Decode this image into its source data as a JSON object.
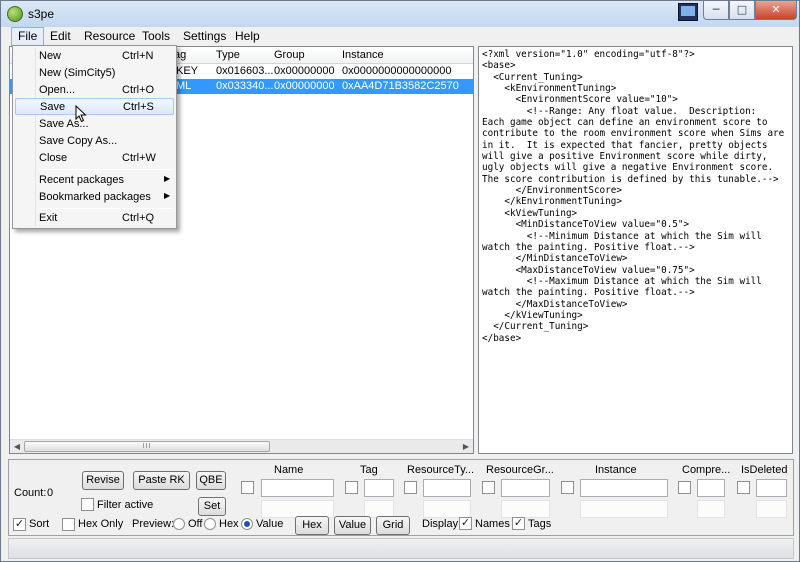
{
  "window": {
    "title": "s3pe"
  },
  "menubar": [
    "File",
    "Edit",
    "Resource",
    "Tools",
    "Settings",
    "Help"
  ],
  "list": {
    "headers": [
      "Tag",
      "Type",
      "Group",
      "Instance"
    ],
    "header_partial": "ag",
    "rows": [
      {
        "tag": "KEY",
        "type": "0x016603...",
        "group": "0x00000000",
        "instance": "0x0000000000000000"
      },
      {
        "tag": "XML",
        "type": "0x033340...",
        "group": "0x00000000",
        "instance": "0xAA4D71B3582C2570"
      }
    ],
    "row_tags_partial": [
      "KEY",
      "ML"
    ]
  },
  "xml_text": "<?xml version=\"1.0\" encoding=\"utf-8\"?>\n<base>\n  <Current_Tuning>\n    <kEnvironmentTuning>\n      <EnvironmentScore value=\"10\">\n        <!--Range: Any float value.  Description:\nEach game object can define an environment score to\ncontribute to the room environment score when Sims are\nin it.  It is expected that fancier, pretty objects\nwill give a positive Environment score while dirty,\nugly objects will give a negative Environment score.\nThe score contribution is defined by this tunable.-->\n      </EnvironmentScore>\n    </kEnvironmentTuning>\n    <kViewTuning>\n      <MinDistanceToView value=\"0.5\">\n        <!--Minimum Distance at which the Sim will\nwatch the painting. Positive float.-->\n      </MinDistanceToView>\n      <MaxDistanceToView value=\"0.75\">\n        <!--Maximum Distance at which the Sim will\nwatch the painting. Positive float.-->\n      </MaxDistanceToView>\n    </kViewTuning>\n  </Current_Tuning>\n</base>",
  "file_menu": {
    "items": [
      {
        "label": "New",
        "shortcut": "Ctrl+N"
      },
      {
        "label": "New (SimCity5)",
        "shortcut": ""
      },
      {
        "label": "Open...",
        "shortcut": "Ctrl+O"
      },
      {
        "label": "Save",
        "shortcut": "Ctrl+S",
        "highlighted": true
      },
      {
        "label": "Save As...",
        "shortcut": ""
      },
      {
        "label": "Save Copy As...",
        "shortcut": ""
      },
      {
        "label": "Close",
        "shortcut": "Ctrl+W"
      },
      {
        "label": "Recent packages",
        "shortcut": "",
        "submenu": true
      },
      {
        "label": "Bookmarked packages",
        "shortcut": "",
        "submenu": true
      },
      {
        "label": "Exit",
        "shortcut": "Ctrl+Q"
      }
    ]
  },
  "filter": {
    "count_label": "Count:",
    "count_value": "0",
    "revise": "Revise",
    "paste_rk": "Paste RK",
    "qbe": "QBE",
    "set": "Set",
    "filter_active": "Filter active",
    "columns": [
      "Name",
      "Tag",
      "ResourceTy...",
      "ResourceGr...",
      "Instance",
      "Compre...",
      "IsDeleted"
    ]
  },
  "view": {
    "sort": "Sort",
    "sort_checked": true,
    "hex_only": "Hex Only",
    "hex_only_checked": false,
    "preview": "Preview:",
    "preview_options": [
      "Off",
      "Hex",
      "Value"
    ],
    "preview_selected": "Value",
    "hex_btn": "Hex",
    "value_btn": "Value",
    "grid_btn": "Grid",
    "display": "Display:",
    "names": "Names",
    "names_checked": true,
    "tags": "Tags",
    "tags_checked": true
  },
  "scroll_glyph": "III",
  "icons": {
    "app": "s3pe-app-icon",
    "monitor": "monitor-icon",
    "minimize": "minimize-icon",
    "maximize": "maximize-icon",
    "close": "close-icon",
    "submenu": "chevron-right-icon",
    "pointer": "mouse-pointer-icon"
  }
}
